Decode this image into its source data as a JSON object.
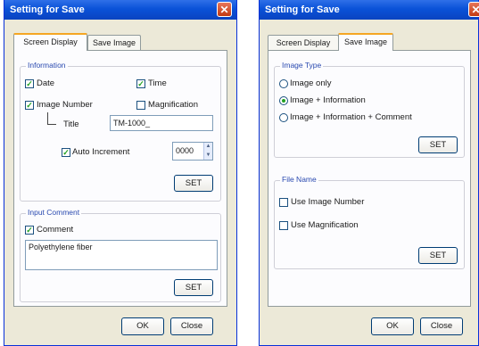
{
  "left_dialog": {
    "title": "Setting for Save",
    "close_glyph": "✕",
    "tabs": [
      "Screen Display",
      "Save Image"
    ],
    "active_tab": "Screen Display",
    "information": {
      "group_label": "Information",
      "date_label": "Date",
      "date_checked": true,
      "time_label": "Time",
      "time_checked": true,
      "image_number_label": "Image Number",
      "image_number_checked": true,
      "magnification_label": "Magnification",
      "magnification_checked": false,
      "title_label": "Title",
      "title_value": "TM-1000_",
      "auto_increment_label": "Auto Increment",
      "auto_increment_checked": true,
      "auto_increment_value": "0000",
      "set_label": "SET"
    },
    "input_comment": {
      "group_label": "Input Comment",
      "comment_label": "Comment",
      "comment_checked": true,
      "comment_value": "Polyethylene fiber",
      "set_label": "SET"
    },
    "ok_label": "OK",
    "close_label": "Close"
  },
  "right_dialog": {
    "title": "Setting for Save",
    "close_glyph": "✕",
    "tabs": [
      "Screen Display",
      "Save Image"
    ],
    "active_tab": "Save Image",
    "image_type": {
      "group_label": "Image Type",
      "options": [
        "Image only",
        "Image + Information",
        "Image + Information + Comment"
      ],
      "selected_index": 1,
      "set_label": "SET"
    },
    "file_name": {
      "group_label": "File Name",
      "use_image_number_label": "Use Image Number",
      "use_image_number_checked": false,
      "use_magnification_label": "Use Magnification",
      "use_magnification_checked": false,
      "set_label": "SET"
    },
    "ok_label": "OK",
    "close_label": "Close"
  },
  "colors": {
    "title_bar": "#0a52d8",
    "close_button": "#c23a12",
    "active_tab_accent": "#f5a623",
    "group_label": "#2a4ab0",
    "check_mark": "#21a121"
  },
  "icons": {
    "check": "check-icon",
    "close": "close-icon",
    "spin_up": "spin-up-icon",
    "spin_down": "spin-down-icon"
  }
}
